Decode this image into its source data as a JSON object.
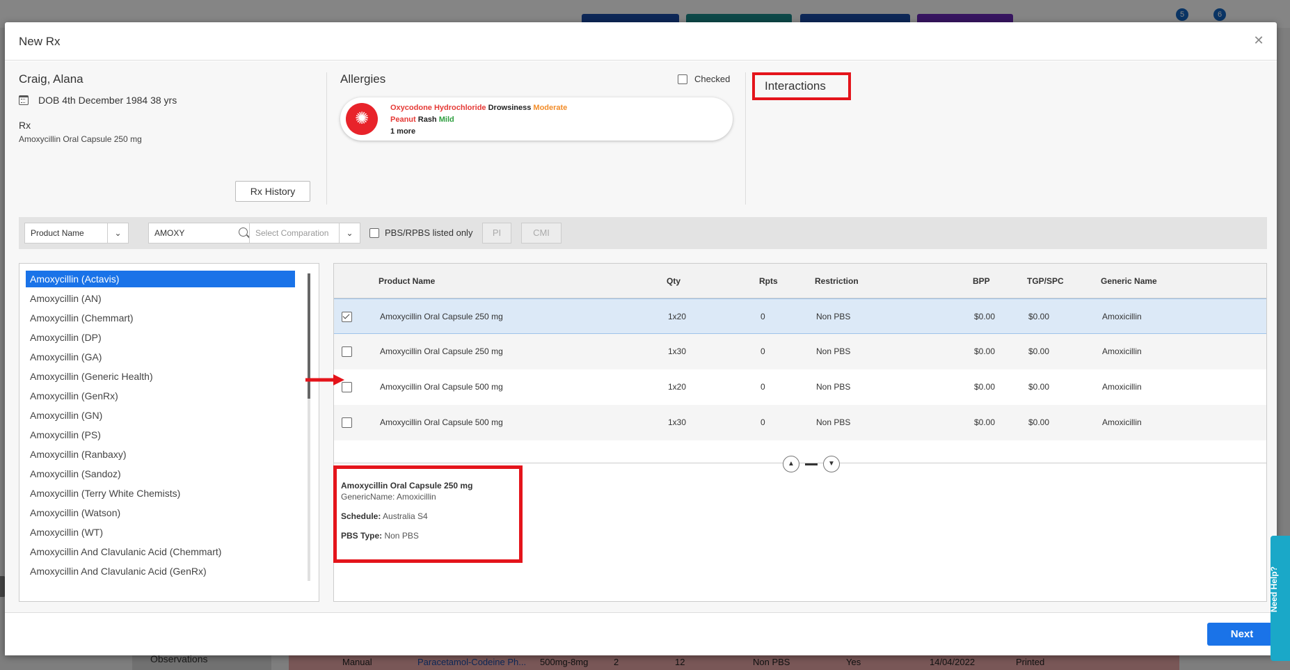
{
  "background": {
    "badges": [
      "5",
      "6"
    ],
    "observations_label": "Observations",
    "bottom_row": {
      "type": "Manual",
      "drug": "Paracetamol-Codeine Ph...",
      "strength": "500mg-8mg",
      "qty": "2",
      "rpts": "12",
      "restriction": "Non PBS",
      "flag": "Yes",
      "date": "14/04/2022",
      "status": "Printed"
    }
  },
  "modal": {
    "title": "New Rx",
    "close_icon": "close-icon"
  },
  "patient": {
    "name": "Craig, Alana",
    "dob": "DOB 4th December 1984 38 yrs",
    "rx_label": "Rx",
    "rx_value": "Amoxycillin Oral Capsule 250 mg",
    "rx_history_label": "Rx History"
  },
  "allergies": {
    "title": "Allergies",
    "checked_label": "Checked",
    "items": [
      {
        "drug": "Oxycodone Hydrochloride",
        "reaction": "Drowsiness",
        "severity": "Moderate"
      },
      {
        "drug": "Peanut",
        "reaction": "Rash",
        "severity": "Mild"
      }
    ],
    "more": "1 more",
    "colors": {
      "drug": "#e53935",
      "moderate": "#f28c28",
      "mild": "#2e9e3f"
    }
  },
  "interactions": {
    "title": "Interactions"
  },
  "search": {
    "search_by": "Product Name",
    "query": "AMOXY",
    "comparison_placeholder": "Select Comparation",
    "pbs_only_label": "PBS/RPBS listed only",
    "pi_label": "PI",
    "cmi_label": "CMI"
  },
  "brands": [
    "Amoxycillin (Actavis)",
    "Amoxycillin (AN)",
    "Amoxycillin (Chemmart)",
    "Amoxycillin (DP)",
    "Amoxycillin (GA)",
    "Amoxycillin (Generic Health)",
    "Amoxycillin (GenRx)",
    "Amoxycillin (GN)",
    "Amoxycillin (PS)",
    "Amoxycillin (Ranbaxy)",
    "Amoxycillin (Sandoz)",
    "Amoxycillin (Terry White Chemists)",
    "Amoxycillin (Watson)",
    "Amoxycillin (WT)",
    "Amoxycillin And Clavulanic Acid (Chemmart)",
    "Amoxycillin And Clavulanic Acid (GenRx)"
  ],
  "selected_brand_index": 0,
  "grid": {
    "columns": [
      "Product Name",
      "Qty",
      "Rpts",
      "Restriction",
      "BPP",
      "TGP/SPC",
      "Generic Name"
    ],
    "rows": [
      {
        "checked": true,
        "product": "Amoxycillin Oral Capsule 250 mg",
        "qty": "1x20",
        "rpts": "0",
        "restriction": "Non PBS",
        "bpp": "$0.00",
        "tgp": "$0.00",
        "generic": "Amoxicillin"
      },
      {
        "checked": false,
        "product": "Amoxycillin Oral Capsule 250 mg",
        "qty": "1x30",
        "rpts": "0",
        "restriction": "Non PBS",
        "bpp": "$0.00",
        "tgp": "$0.00",
        "generic": "Amoxicillin"
      },
      {
        "checked": false,
        "product": "Amoxycillin Oral Capsule 500 mg",
        "qty": "1x20",
        "rpts": "0",
        "restriction": "Non PBS",
        "bpp": "$0.00",
        "tgp": "$0.00",
        "generic": "Amoxicillin"
      },
      {
        "checked": false,
        "product": "Amoxycillin Oral Capsule 500 mg",
        "qty": "1x30",
        "rpts": "0",
        "restriction": "Non PBS",
        "bpp": "$0.00",
        "tgp": "$0.00",
        "generic": "Amoxicillin"
      }
    ]
  },
  "details": {
    "product": "Amoxycillin Oral Capsule 250 mg",
    "generic_line": "GenericName: Amoxicillin",
    "schedule_label": "Schedule:",
    "schedule_value": "Australia S4",
    "pbs_label": "PBS Type:",
    "pbs_value": "Non PBS"
  },
  "footer": {
    "next_label": "Next"
  },
  "help": {
    "label": "Need Help?"
  },
  "colors": {
    "accent": "#1a73e8",
    "highlight_box": "#e4141b",
    "help_tab": "#1aa8c8"
  }
}
